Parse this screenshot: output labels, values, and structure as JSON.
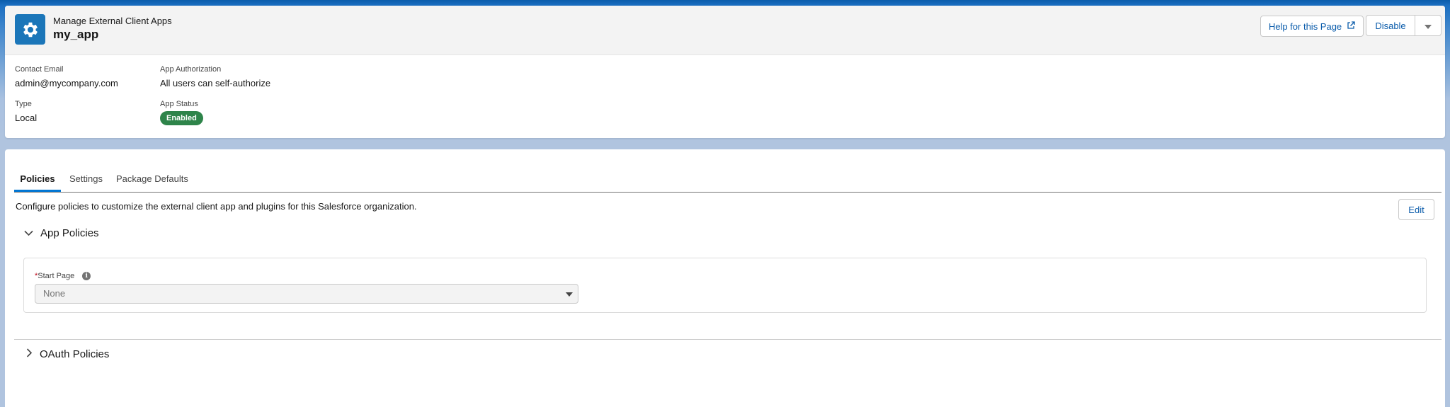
{
  "header": {
    "breadcrumb": "Manage External Client Apps",
    "title": "my_app",
    "help_button": "Help for this Page",
    "disable_button": "Disable",
    "fields": {
      "contact_email_label": "Contact Email",
      "contact_email_value": "admin@mycompany.com",
      "app_authorization_label": "App Authorization",
      "app_authorization_value": "All users can self-authorize",
      "type_label": "Type",
      "type_value": "Local",
      "app_status_label": "App Status",
      "app_status_value": "Enabled"
    }
  },
  "tabs": [
    {
      "label": "Policies",
      "active": true
    },
    {
      "label": "Settings",
      "active": false
    },
    {
      "label": "Package Defaults",
      "active": false
    }
  ],
  "policies": {
    "description": "Configure policies to customize the external client app and plugins for this Salesforce organization.",
    "edit_button": "Edit",
    "app_policies_title": "App Policies",
    "start_page_required": "*",
    "start_page_label": "Start Page",
    "start_page_value": "None",
    "oauth_policies_title": "OAuth Policies"
  },
  "colors": {
    "brand_blue": "#0176d3",
    "icon_bg": "#1b76b9",
    "status_green": "#2e844a",
    "link_blue": "#0b5cab"
  }
}
